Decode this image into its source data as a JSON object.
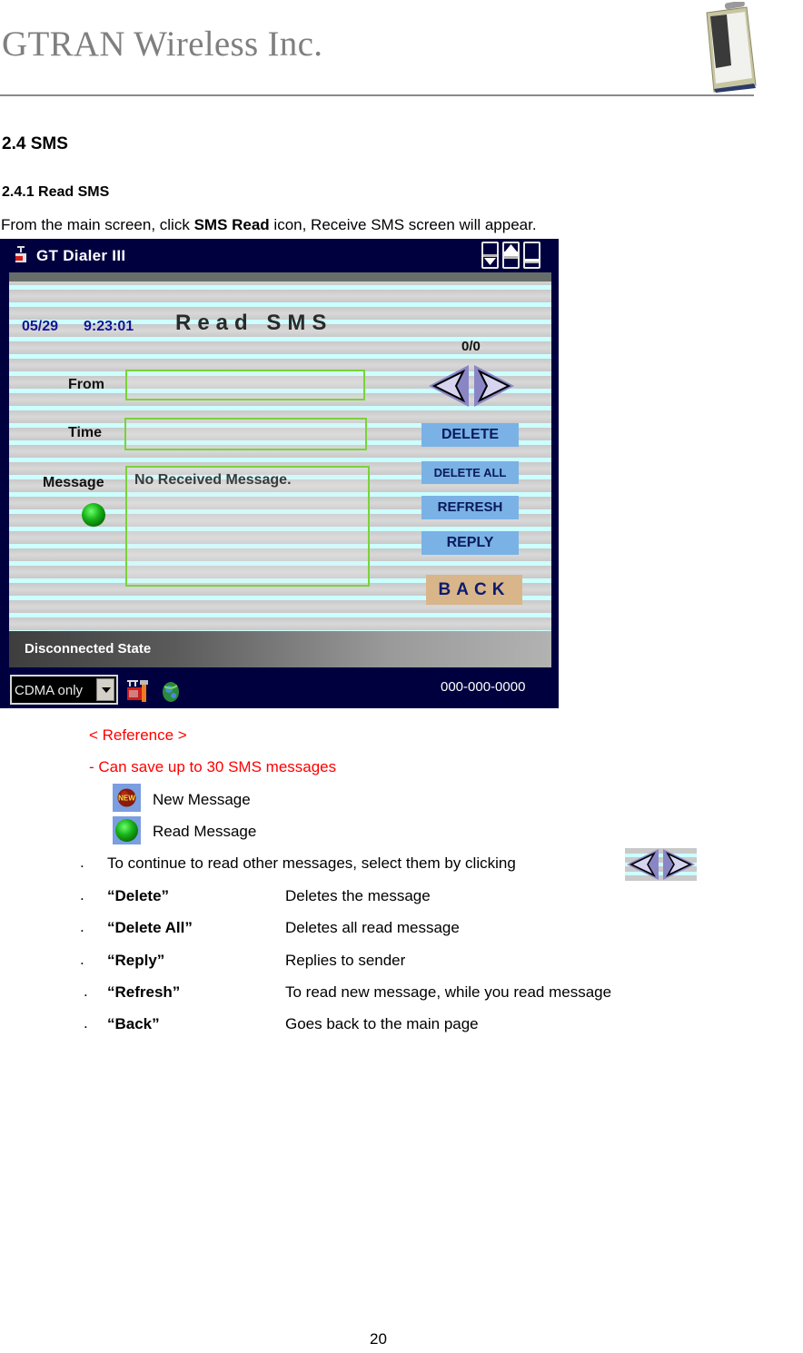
{
  "header": {
    "company": "GTRAN Wireless Inc."
  },
  "section": {
    "title": "2.4 SMS",
    "subtitle": "2.4.1 Read SMS",
    "intro_before": "From the main screen, click ",
    "intro_bold": "SMS Read",
    "intro_after": " icon, Receive SMS screen will appear."
  },
  "app": {
    "window_title": "GT Dialer III",
    "window_buttons": [
      "minimize",
      "maximize",
      "restore"
    ],
    "date": "05/29",
    "time": "9:23:01",
    "screen_title": "Read SMS",
    "counter": "0/0",
    "fields": {
      "from_label": "From",
      "from_value": "",
      "time_label": "Time",
      "time_value": "",
      "message_label": "Message",
      "message_value": "No Received Message."
    },
    "buttons": {
      "delete": "DELETE",
      "delete_all": "DELETE ALL",
      "refresh": "REFRESH",
      "reply": "REPLY",
      "back": "BACK"
    },
    "status": "Disconnected State",
    "network_mode": "CDMA only",
    "phone_number": "000-000-0000",
    "colors": {
      "frame": "#00003f",
      "field_border": "#7ad23a",
      "button_blue": "#7ab2e6",
      "button_back": "#d9b58a"
    }
  },
  "reference": {
    "heading": "< Reference >",
    "note": "- Can save up to 30 SMS messages",
    "legend": [
      {
        "icon": "new-message-icon",
        "label": "New Message"
      },
      {
        "icon": "read-message-icon",
        "label": "Read Message"
      }
    ]
  },
  "instructions": {
    "bullet": ".",
    "navigate": "To continue to read other messages, select them by clicking",
    "items": [
      {
        "term": "“Delete”",
        "desc": "Deletes the message"
      },
      {
        "term": "“Delete All”",
        "desc": "Deletes all read message"
      },
      {
        "term": "“Reply”",
        "desc": "Replies to sender"
      },
      {
        "term": "“Refresh”",
        "desc": "To read new message, while you read message"
      },
      {
        "term": "“Back”",
        "desc": "Goes back to the main page"
      }
    ]
  },
  "footer": {
    "page_number": "20"
  }
}
